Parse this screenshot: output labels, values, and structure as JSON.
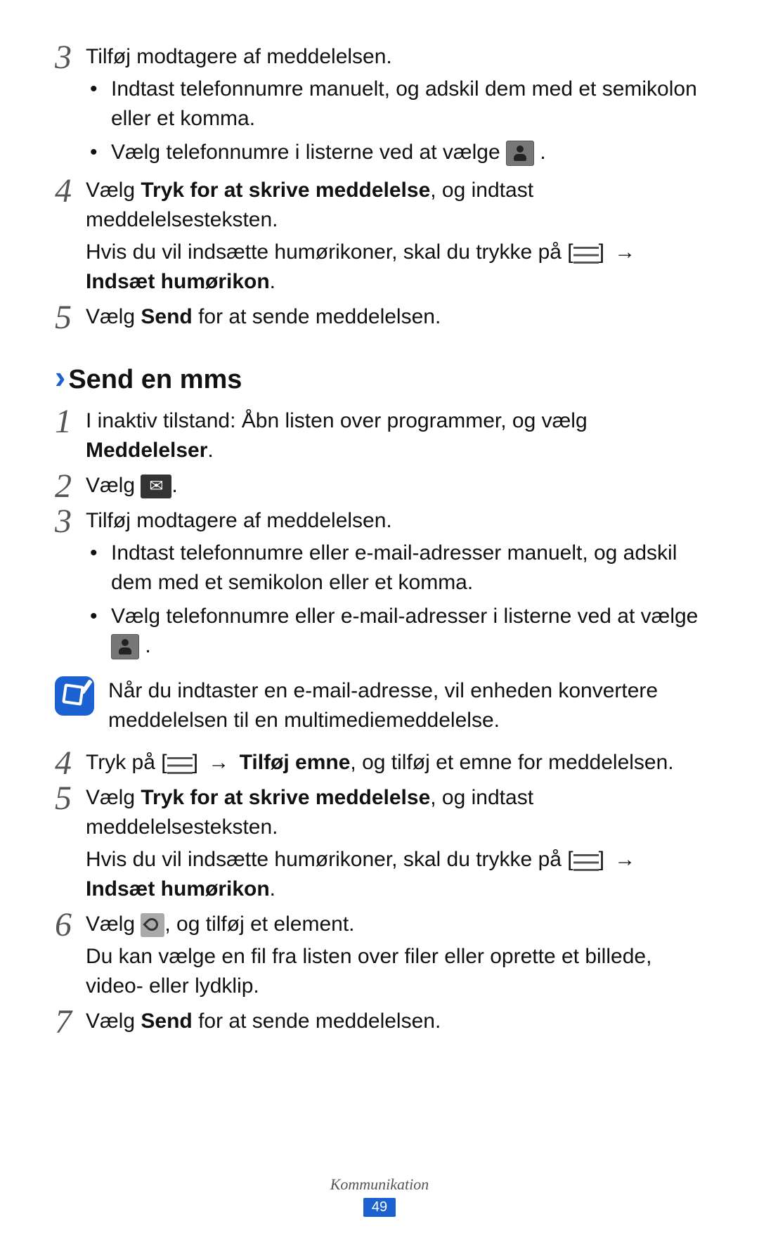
{
  "top_steps": {
    "s3": {
      "num": "3",
      "text": "Tilføj modtagere af meddelelsen.",
      "bullets": [
        "Indtast telefonnumre manuelt, og adskil dem med et semikolon eller et komma.",
        "Vælg telefonnumre i listerne ved at vælge "
      ],
      "bullet2_trail": "."
    },
    "s4": {
      "num": "4",
      "line1_a": "Vælg ",
      "line1_b": "Tryk for at skrive meddelelse",
      "line1_c": ", og indtast meddelelsesteksten.",
      "line2_a": "Hvis du vil indsætte humørikoner, skal du trykke på [",
      "line2_b": "] ",
      "arrow": "→",
      "line3_b": "Indsæt humørikon",
      "line3_c": "."
    },
    "s5": {
      "num": "5",
      "a": "Vælg ",
      "b": "Send",
      "c": " for at sende meddelelsen."
    }
  },
  "section": {
    "chevron": "›",
    "title": "Send en mms"
  },
  "mms_steps": {
    "s1": {
      "num": "1",
      "a": "I inaktiv tilstand: Åbn listen over programmer, og vælg ",
      "b": "Meddelelser",
      "c": "."
    },
    "s2": {
      "num": "2",
      "a": "Vælg ",
      "trail": "."
    },
    "s3": {
      "num": "3",
      "text": "Tilføj modtagere af meddelelsen.",
      "bullets": [
        "Indtast telefonnumre eller e-mail-adresser manuelt, og adskil dem med et semikolon eller et komma.",
        "Vælg telefonnumre eller e-mail-adresser i listerne ved at vælge "
      ],
      "bullet2_trail": "."
    },
    "note": "Når du indtaster en e-mail-adresse, vil enheden konvertere meddelelsen til en multimediemeddelelse.",
    "s4": {
      "num": "4",
      "a": "Tryk på [",
      "b": "] ",
      "arrow": "→",
      "c": " ",
      "d": "Tilføj emne",
      "e": ", og tilføj et emne for meddelelsen."
    },
    "s5": {
      "num": "5",
      "a": "Vælg ",
      "b": "Tryk for at skrive meddelelse",
      "c": ", og indtast meddelelsesteksten.",
      "d": "Hvis du vil indsætte humørikoner, skal du trykke på [",
      "e": "] ",
      "arrow": "→",
      "f_b": "Indsæt humørikon",
      "f_c": "."
    },
    "s6": {
      "num": "6",
      "a": "Vælg ",
      "b": ", og tilføj et element.",
      "c": "Du kan vælge en fil fra listen over filer eller oprette et billede, video- eller lydklip."
    },
    "s7": {
      "num": "7",
      "a": "Vælg ",
      "b": "Send",
      "c": " for at sende meddelelsen."
    }
  },
  "footer": {
    "section": "Kommunikation",
    "page": "49"
  }
}
